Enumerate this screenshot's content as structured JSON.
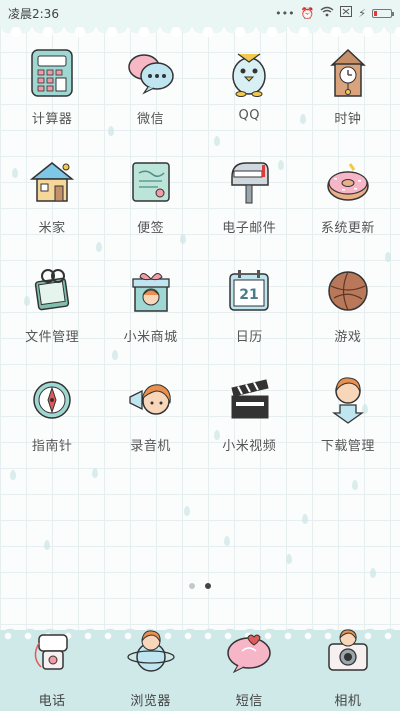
{
  "status_bar": {
    "time": "凌晨2:36",
    "icons": [
      "more-dots-icon",
      "alarm-icon",
      "wifi-icon",
      "sim-off-icon",
      "charging-icon",
      "battery-icon"
    ],
    "battery_level": 0.18,
    "battery_color": "#e03a3a"
  },
  "apps": [
    {
      "label": "计算器",
      "icon": "calculator-icon"
    },
    {
      "label": "微信",
      "icon": "wechat-icon"
    },
    {
      "label": "QQ",
      "icon": "qq-penguin-icon"
    },
    {
      "label": "时钟",
      "icon": "clock-icon"
    },
    {
      "label": "米家",
      "icon": "house-icon"
    },
    {
      "label": "便签",
      "icon": "notes-icon"
    },
    {
      "label": "电子邮件",
      "icon": "mailbox-icon"
    },
    {
      "label": "系统更新",
      "icon": "donut-icon"
    },
    {
      "label": "文件管理",
      "icon": "file-clip-icon"
    },
    {
      "label": "小米商城",
      "icon": "gift-box-icon"
    },
    {
      "label": "日历",
      "icon": "calendar-icon"
    },
    {
      "label": "游戏",
      "icon": "game-ball-icon"
    },
    {
      "label": "指南针",
      "icon": "compass-icon"
    },
    {
      "label": "录音机",
      "icon": "megaphone-girl-icon"
    },
    {
      "label": "小米视频",
      "icon": "clapperboard-icon"
    },
    {
      "label": "下载管理",
      "icon": "download-girl-icon"
    }
  ],
  "calendar_day": "21",
  "pager": {
    "pages": 2,
    "current": 2
  },
  "dock": [
    {
      "label": "电话",
      "icon": "phone-icon"
    },
    {
      "label": "浏览器",
      "icon": "planet-girl-icon"
    },
    {
      "label": "短信",
      "icon": "message-heart-icon"
    },
    {
      "label": "相机",
      "icon": "camera-icon"
    }
  ],
  "colors": {
    "accent": "#9fd8d3",
    "dock_bg": "#cfe9e9",
    "label": "#555555"
  }
}
